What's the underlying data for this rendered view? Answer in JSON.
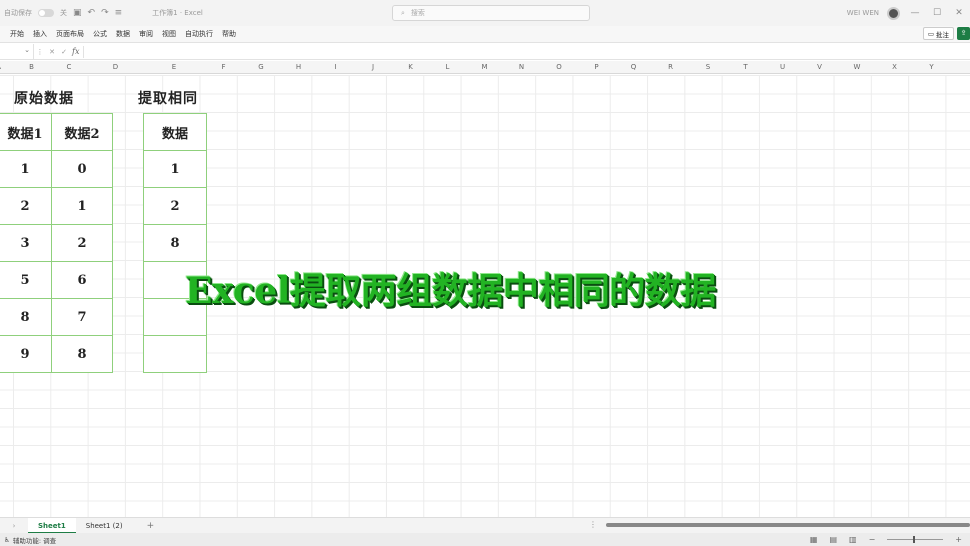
{
  "titlebar": {
    "autosave_label": "自动保存",
    "autosave_state": "关",
    "doc_title": "工作簿1 · Excel",
    "search_placeholder": "搜索",
    "user_name": "WEI WEN"
  },
  "ribbon": {
    "tabs": [
      "开始",
      "插入",
      "页面布局",
      "公式",
      "数据",
      "审阅",
      "视图",
      "自动执行",
      "帮助"
    ],
    "comment_label": "批注"
  },
  "formula_bar": {
    "fx_label": "fx",
    "name_box": ""
  },
  "columns": [
    "A",
    "B",
    "C",
    "D",
    "E",
    "F",
    "G",
    "H",
    "I",
    "J",
    "K",
    "L",
    "M",
    "N",
    "O",
    "P",
    "Q",
    "R",
    "S",
    "T",
    "U",
    "V",
    "W",
    "X",
    "Y"
  ],
  "sheet": {
    "original_heading": "原始数据",
    "extract_heading": "提取相同",
    "original_table": {
      "headers": [
        "数据1",
        "数据2"
      ],
      "rows": [
        [
          "1",
          "0"
        ],
        [
          "2",
          "1"
        ],
        [
          "3",
          "2"
        ],
        [
          "5",
          "6"
        ],
        [
          "8",
          "7"
        ],
        [
          "9",
          "8"
        ]
      ]
    },
    "extract_table": {
      "header": "数据",
      "rows": [
        "1",
        "2",
        "8",
        "",
        "",
        ""
      ]
    }
  },
  "overlay_title": "Excel提取两组数据中相同的数据",
  "tabs_bar": {
    "sheets": [
      "Sheet1",
      "Sheet1 (2)"
    ],
    "active_index": 0
  },
  "statusbar": {
    "accessibility": "辅助功能: 调查"
  },
  "colors": {
    "accent": "#1e7d45",
    "table_border": "#8fd07c",
    "overlay_text": "#22b323"
  }
}
